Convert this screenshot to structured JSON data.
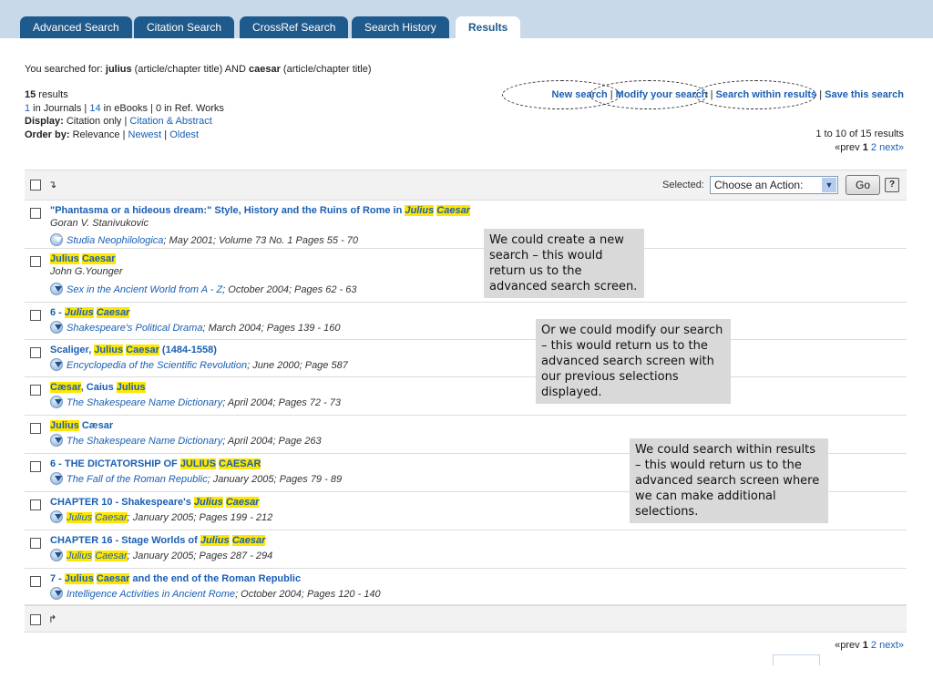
{
  "tabs": [
    {
      "label": "Advanced Search"
    },
    {
      "label": "Citation Search"
    },
    {
      "label": "CrossRef Search"
    },
    {
      "label": "Search History"
    },
    {
      "label": "Results"
    }
  ],
  "query": {
    "prefix": "You searched for: ",
    "term1": "julius",
    "field1": " (article/chapter title) AND ",
    "term2": "caesar",
    "field2": " (article/chapter title)"
  },
  "summary": {
    "count": "15",
    "count_suffix": " results",
    "journals_count": "1",
    "journals_text": " in Journals | ",
    "ebooks_count": "14",
    "ebooks_text": " in eBooks | 0 in Ref. Works"
  },
  "display": {
    "label": "Display:",
    "current": " Citation only | ",
    "option": "Citation & Abstract"
  },
  "order": {
    "label": "Order by:",
    "current": " Relevance | ",
    "newest": "Newest",
    "sep": " | ",
    "oldest": "Oldest"
  },
  "actions": {
    "new_search": "New search",
    "modify": "Modify your search",
    "within": "Search within results",
    "save": "Save this search",
    "sep": " | "
  },
  "pagination": {
    "range": "1 to 10 of 15 results",
    "prev": "«prev ",
    "current": "1",
    "next_page": "2",
    "next": "next»"
  },
  "toolbar": {
    "selected_label": "Selected:",
    "select_value": "Choose an Action:",
    "go": "Go",
    "help": "?"
  },
  "results": [
    {
      "title": [
        {
          "t": "\"Phantasma or a hideous dream:\" Style, History and the Ruins of Rome in "
        },
        {
          "t": "Julius",
          "h": "i"
        },
        {
          "t": " "
        },
        {
          "t": "Caesar",
          "h": "i"
        }
      ],
      "author": "Goran V. Stanivukovic",
      "source_name": "Studia Neophilologica",
      "source_rest": "; May 2001; Volume 73 No. 1 Pages 55 - 70",
      "icon": "journal-icon"
    },
    {
      "title": [
        {
          "t": "Julius",
          "h": "n"
        },
        {
          "t": " "
        },
        {
          "t": "Caesar",
          "h": "n"
        }
      ],
      "author": "John G.Younger",
      "source_name": "Sex in the Ancient World from A - Z",
      "source_rest": "; October 2004; Pages 62 - 63",
      "icon": "ebook-icon"
    },
    {
      "title": [
        {
          "t": "6 - "
        },
        {
          "t": "Julius",
          "h": "i"
        },
        {
          "t": " "
        },
        {
          "t": "Caesar",
          "h": "i"
        }
      ],
      "author": "",
      "source_name": "Shakespeare's Political Drama",
      "source_rest": "; March 2004; Pages 139 - 160",
      "icon": "ebook-icon"
    },
    {
      "title": [
        {
          "t": "Scaliger, "
        },
        {
          "t": "Julius",
          "h": "n"
        },
        {
          "t": " "
        },
        {
          "t": "Caesar",
          "h": "n"
        },
        {
          "t": " (1484-1558)"
        }
      ],
      "author": "",
      "source_name": "Encyclopedia of the Scientific Revolution",
      "source_rest": "; June 2000; Page 587",
      "icon": "ebook-icon"
    },
    {
      "title": [
        {
          "t": "Cæsar",
          "h": "n"
        },
        {
          "t": ", Caius "
        },
        {
          "t": "Julius",
          "h": "n"
        }
      ],
      "author": "",
      "source_name": "The Shakespeare Name Dictionary",
      "source_rest": "; April 2004; Pages 72 - 73",
      "icon": "ebook-icon"
    },
    {
      "title": [
        {
          "t": "Julius",
          "h": "n"
        },
        {
          "t": " Cæsar"
        }
      ],
      "author": "",
      "source_name": "The Shakespeare Name Dictionary",
      "source_rest": "; April 2004; Page 263",
      "icon": "ebook-icon"
    },
    {
      "title": [
        {
          "t": "6 - THE DICTATORSHIP OF "
        },
        {
          "t": "JULIUS",
          "h": "n"
        },
        {
          "t": " "
        },
        {
          "t": "CAESAR",
          "h": "n"
        }
      ],
      "author": "",
      "source_name": "The Fall of the Roman Republic",
      "source_rest": "; January 2005; Pages 79 - 89",
      "icon": "ebook-icon"
    },
    {
      "title": [
        {
          "t": "CHAPTER 10 - Shakespeare's "
        },
        {
          "t": "Julius",
          "h": "i"
        },
        {
          "t": " "
        },
        {
          "t": "Caesar",
          "h": "i"
        }
      ],
      "author": "",
      "source_name": "Julius Caesar",
      "source_rest": "; January 2005; Pages 199 - 212",
      "icon": "ebook-icon"
    },
    {
      "title": [
        {
          "t": "CHAPTER 16 - Stage Worlds of "
        },
        {
          "t": "Julius",
          "h": "i"
        },
        {
          "t": " "
        },
        {
          "t": "Caesar",
          "h": "i"
        }
      ],
      "author": "",
      "source_name": "Julius Caesar",
      "source_rest": "; January 2005; Pages 287 - 294",
      "icon": "ebook-icon"
    },
    {
      "title": [
        {
          "t": "7 - "
        },
        {
          "t": "Julius",
          "h": "n"
        },
        {
          "t": " "
        },
        {
          "t": "Caesar",
          "h": "n"
        },
        {
          "t": " and the end of the Roman Republic"
        }
      ],
      "author": "",
      "source_name": "Intelligence Activities in Ancient Rome",
      "source_rest": "; October 2004; Pages 120 - 140",
      "icon": "ebook-icon"
    }
  ],
  "notes": {
    "note1": "We could  create a new search – this would return us to the advanced search screen.",
    "note2": "Or we could modify our search – this would return us to the advanced search screen with our previous selections displayed.",
    "note3": "We could search within results – this would return us to the advanced search screen where we can make additional selections."
  },
  "colors": {
    "tab_bg": "#1f5a8c",
    "tabbar_bg": "#c8d9ea",
    "link": "#1a5fb4",
    "highlight": "#ffe600",
    "note_bg": "#d9d9d9"
  }
}
